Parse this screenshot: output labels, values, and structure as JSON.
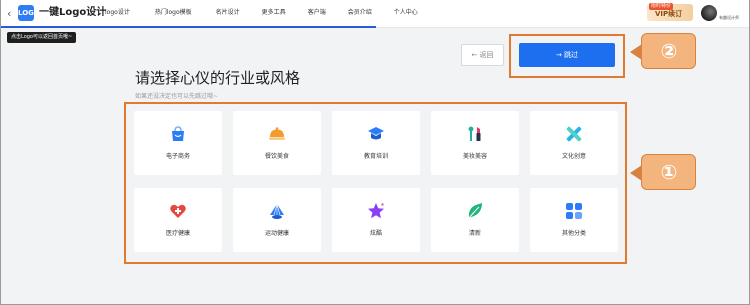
{
  "topbar": {
    "back_glyph": "‹",
    "logo_text": "LOGO",
    "brand": "一键Logo设计",
    "nav_items": [
      "logo设计",
      "热门logo模板",
      "名片设计",
      "更多工具",
      "客户端",
      "会员介绍",
      "个人中心"
    ],
    "vip_tag": "限时特价",
    "vip_label": "VIP续订",
    "user_name": "有趣设计师"
  },
  "tooltip": "点击Logo可以返回首页哦~",
  "buttons": {
    "back_label": "← 返回",
    "skip_label": "→   跳过"
  },
  "callouts": [
    "②",
    "①"
  ],
  "heading": {
    "title": "请选择心仪的行业或风格",
    "subtitle": "如果还没决定也可以先跳过哦~"
  },
  "categories": [
    {
      "label": "电子商务",
      "icon": "shopping-bag-icon",
      "color": "#2b7cf6"
    },
    {
      "label": "餐饮美食",
      "icon": "food-cloche-icon",
      "color": "#f59a2c"
    },
    {
      "label": "教育培训",
      "icon": "graduation-cap-icon",
      "color": "#2b7cf6"
    },
    {
      "label": "美妆美容",
      "icon": "lipstick-icon",
      "color": "#e5395d"
    },
    {
      "label": "文化创意",
      "icon": "pencil-ruler-icon",
      "color": "#27b3e8"
    },
    {
      "label": "医疗健康",
      "icon": "medical-heart-icon",
      "color": "#e8453c"
    },
    {
      "label": "运动健康",
      "icon": "shuttlecock-icon",
      "color": "#2b7cf6"
    },
    {
      "label": "炫酷",
      "icon": "star-icon",
      "color": "#8a3ff2"
    },
    {
      "label": "清新",
      "icon": "leaf-icon",
      "color": "#21b57a"
    },
    {
      "label": "其他分类",
      "icon": "grid-icon",
      "color": "#2b7cf6"
    }
  ]
}
